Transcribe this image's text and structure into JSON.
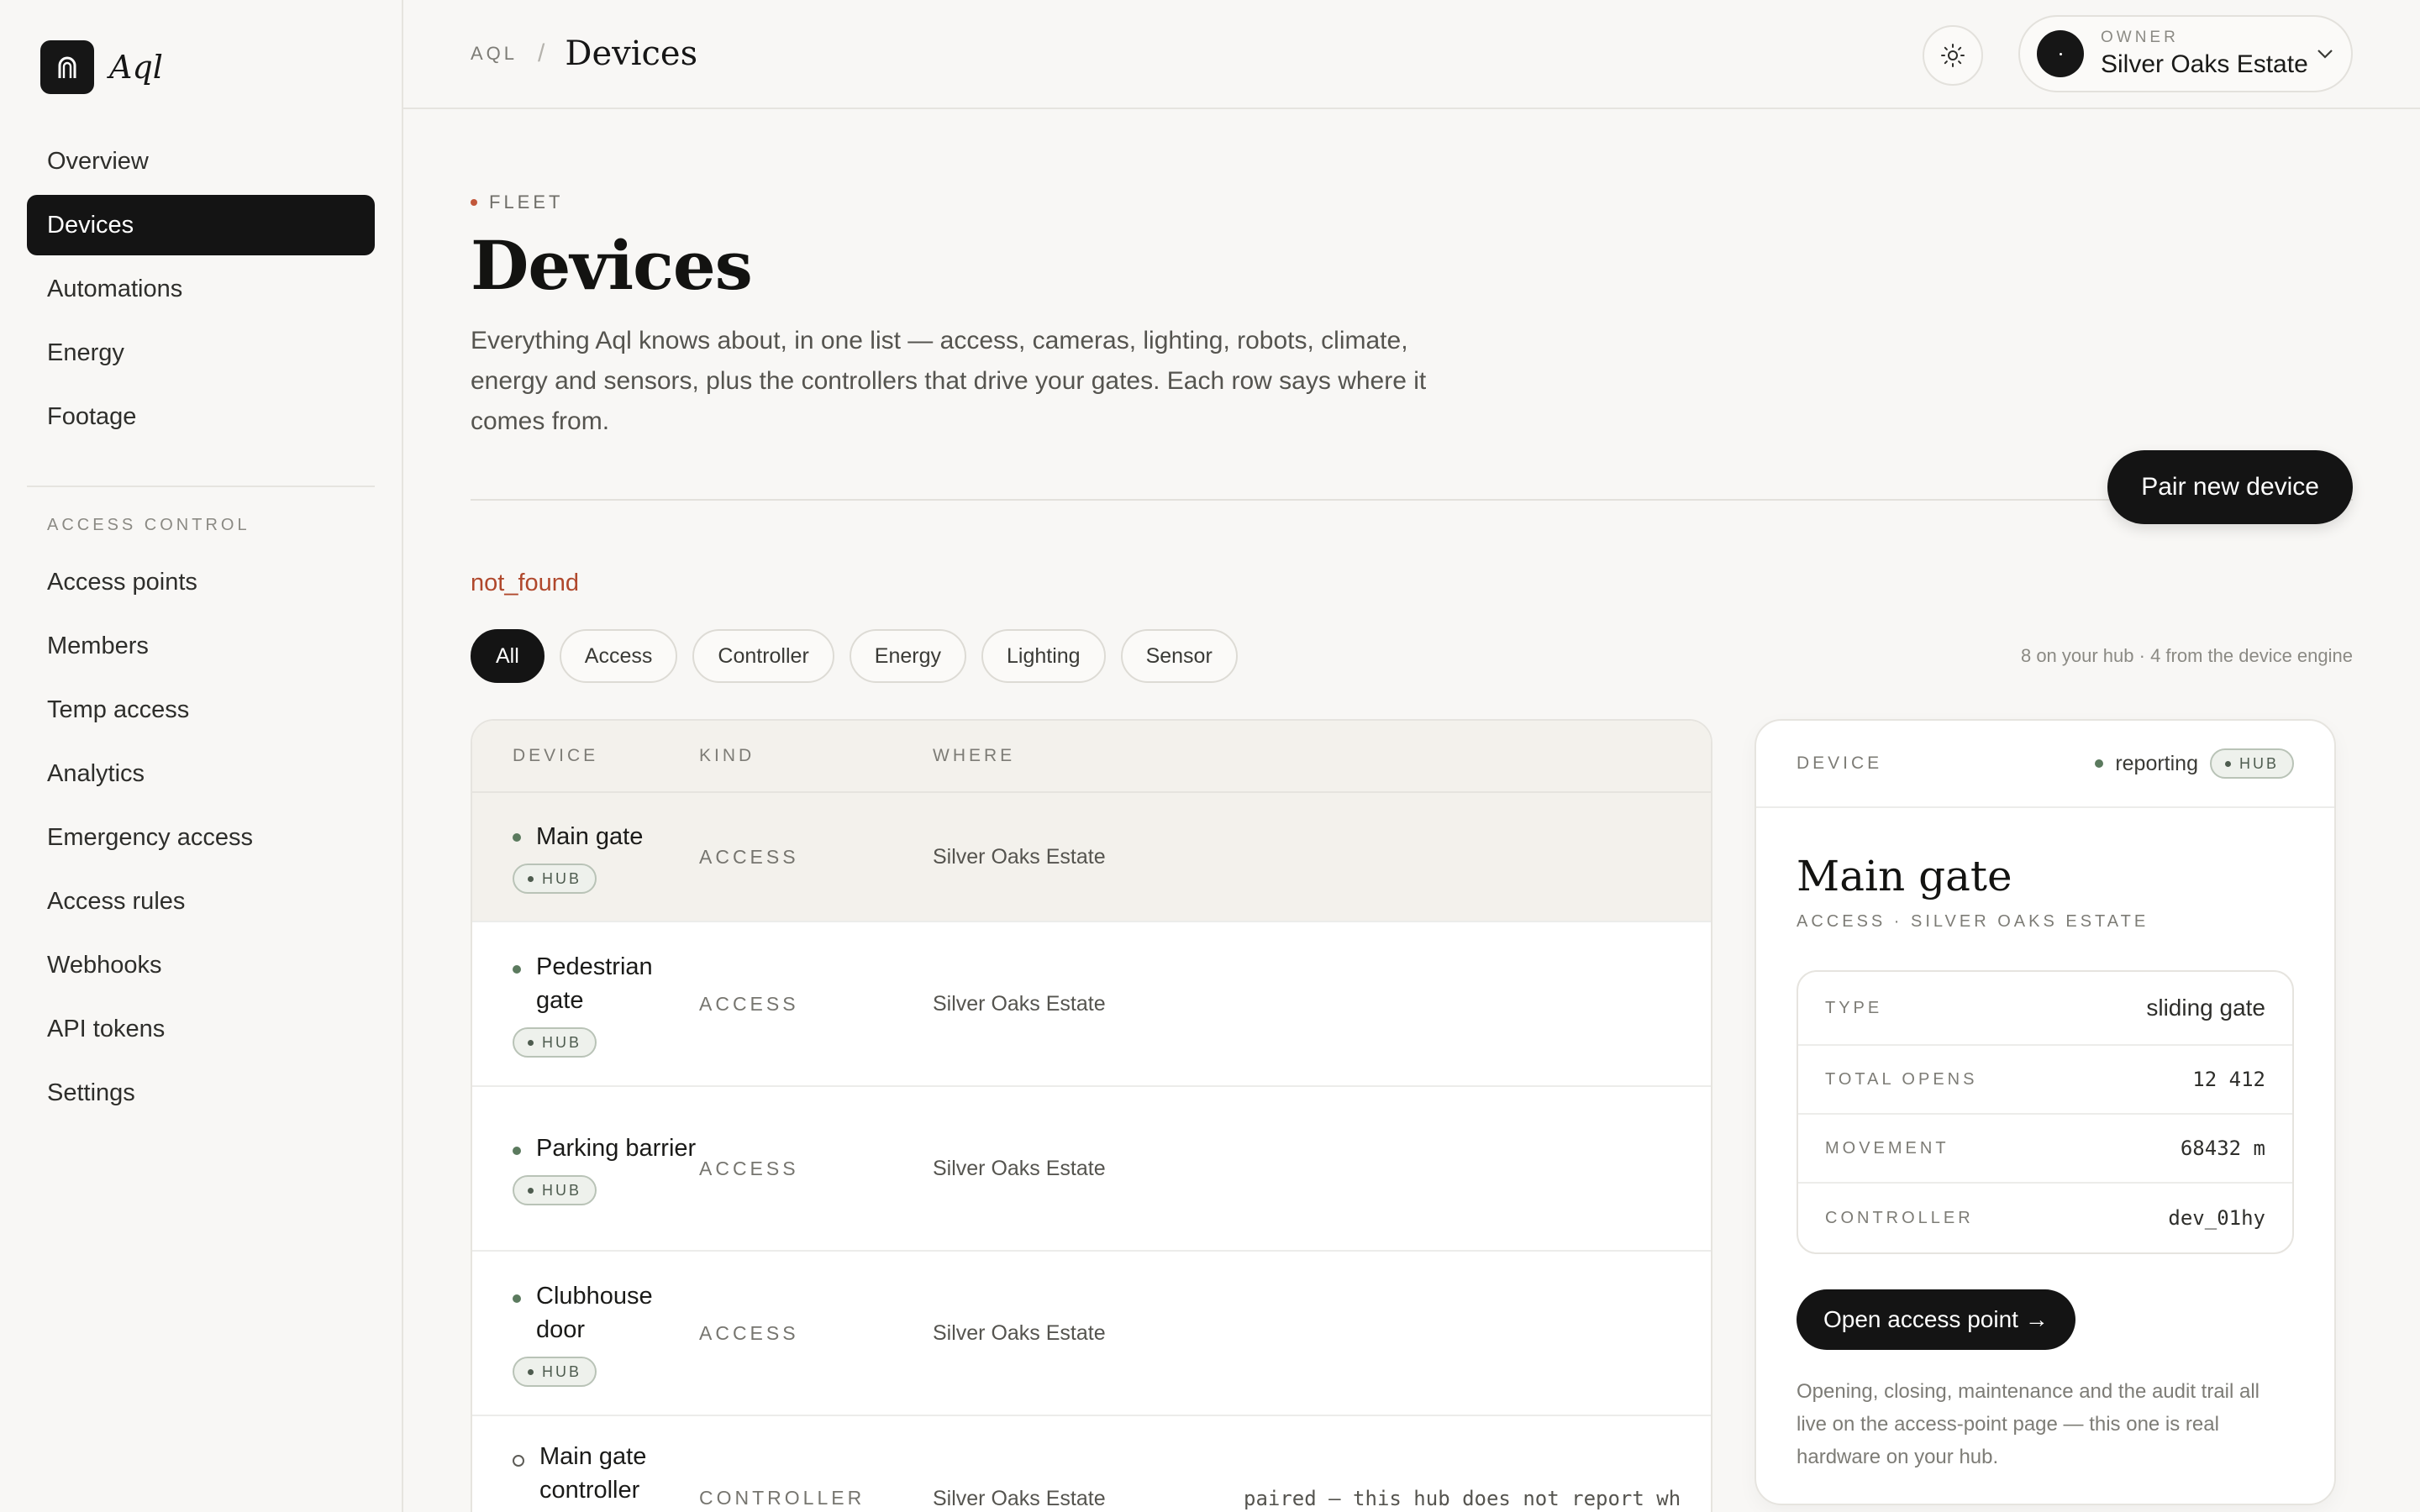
{
  "brand": {
    "name": "Aql"
  },
  "sidebar": {
    "primary": [
      {
        "label": "Overview"
      },
      {
        "label": "Devices",
        "active": true
      },
      {
        "label": "Automations"
      },
      {
        "label": "Energy"
      },
      {
        "label": "Footage"
      }
    ],
    "section_label": "ACCESS CONTROL",
    "secondary": [
      {
        "label": "Access points"
      },
      {
        "label": "Members"
      },
      {
        "label": "Temp access"
      },
      {
        "label": "Analytics"
      },
      {
        "label": "Emergency access"
      },
      {
        "label": "Access rules"
      },
      {
        "label": "Webhooks"
      },
      {
        "label": "API tokens"
      },
      {
        "label": "Settings"
      }
    ]
  },
  "topbar": {
    "breadcrumb_root": "AQL",
    "breadcrumb_sep": "/",
    "breadcrumb_current": "Devices",
    "owner_label": "OWNER",
    "owner_name": "Silver Oaks Estate"
  },
  "header": {
    "eyebrow": "FLEET",
    "title": "Devices",
    "intro": "Everything Aql knows about, in one list — access, cameras, lighting, robots, climate, energy and sensors, plus the controllers that drive your gates. Each row says where it comes from.",
    "pair_button": "Pair new device",
    "error": "not_found"
  },
  "filters": {
    "chips": [
      {
        "label": "All",
        "active": true
      },
      {
        "label": "Access"
      },
      {
        "label": "Controller"
      },
      {
        "label": "Energy"
      },
      {
        "label": "Lighting"
      },
      {
        "label": "Sensor"
      }
    ],
    "meta": "8 on your hub · 4 from the device engine"
  },
  "table": {
    "columns": {
      "device": "DEVICE",
      "kind": "KIND",
      "where": "WHERE"
    },
    "rows": [
      {
        "name": "Main gate",
        "badge": "HUB",
        "kind": "ACCESS",
        "where": "Silver Oaks Estate",
        "note": ""
      },
      {
        "name": "Pedestrian gate",
        "badge": "HUB",
        "kind": "ACCESS",
        "where": "Silver Oaks Estate",
        "note": ""
      },
      {
        "name": "Parking barrier",
        "badge": "HUB",
        "kind": "ACCESS",
        "where": "Silver Oaks Estate",
        "note": ""
      },
      {
        "name": "Clubhouse door",
        "badge": "HUB",
        "kind": "ACCESS",
        "where": "Silver Oaks Estate",
        "note": ""
      },
      {
        "name": "Main gate controller",
        "badge": "",
        "kind": "CONTROLLER",
        "where": "Silver Oaks Estate",
        "note": "paired — this hub does not report wh"
      }
    ]
  },
  "detail": {
    "head_label": "DEVICE",
    "status": "reporting",
    "badge": "HUB",
    "title": "Main gate",
    "subtitle": "ACCESS · SILVER OAKS ESTATE",
    "props": [
      {
        "key": "TYPE",
        "value": "sliding gate"
      },
      {
        "key": "TOTAL OPENS",
        "value": "12 412"
      },
      {
        "key": "MOVEMENT",
        "value": "68432 m"
      },
      {
        "key": "CONTROLLER",
        "value": "dev_01hy"
      }
    ],
    "open_button": "Open access point →",
    "note": "Opening, closing, maintenance and the audit trail all live on the access-point page — this one is real hardware on your hub."
  },
  "colors": {
    "accent_dark": "#141414",
    "status_green": "#5b7a5e",
    "error": "#b0482c",
    "eyebrow_dot": "#c2573a"
  }
}
